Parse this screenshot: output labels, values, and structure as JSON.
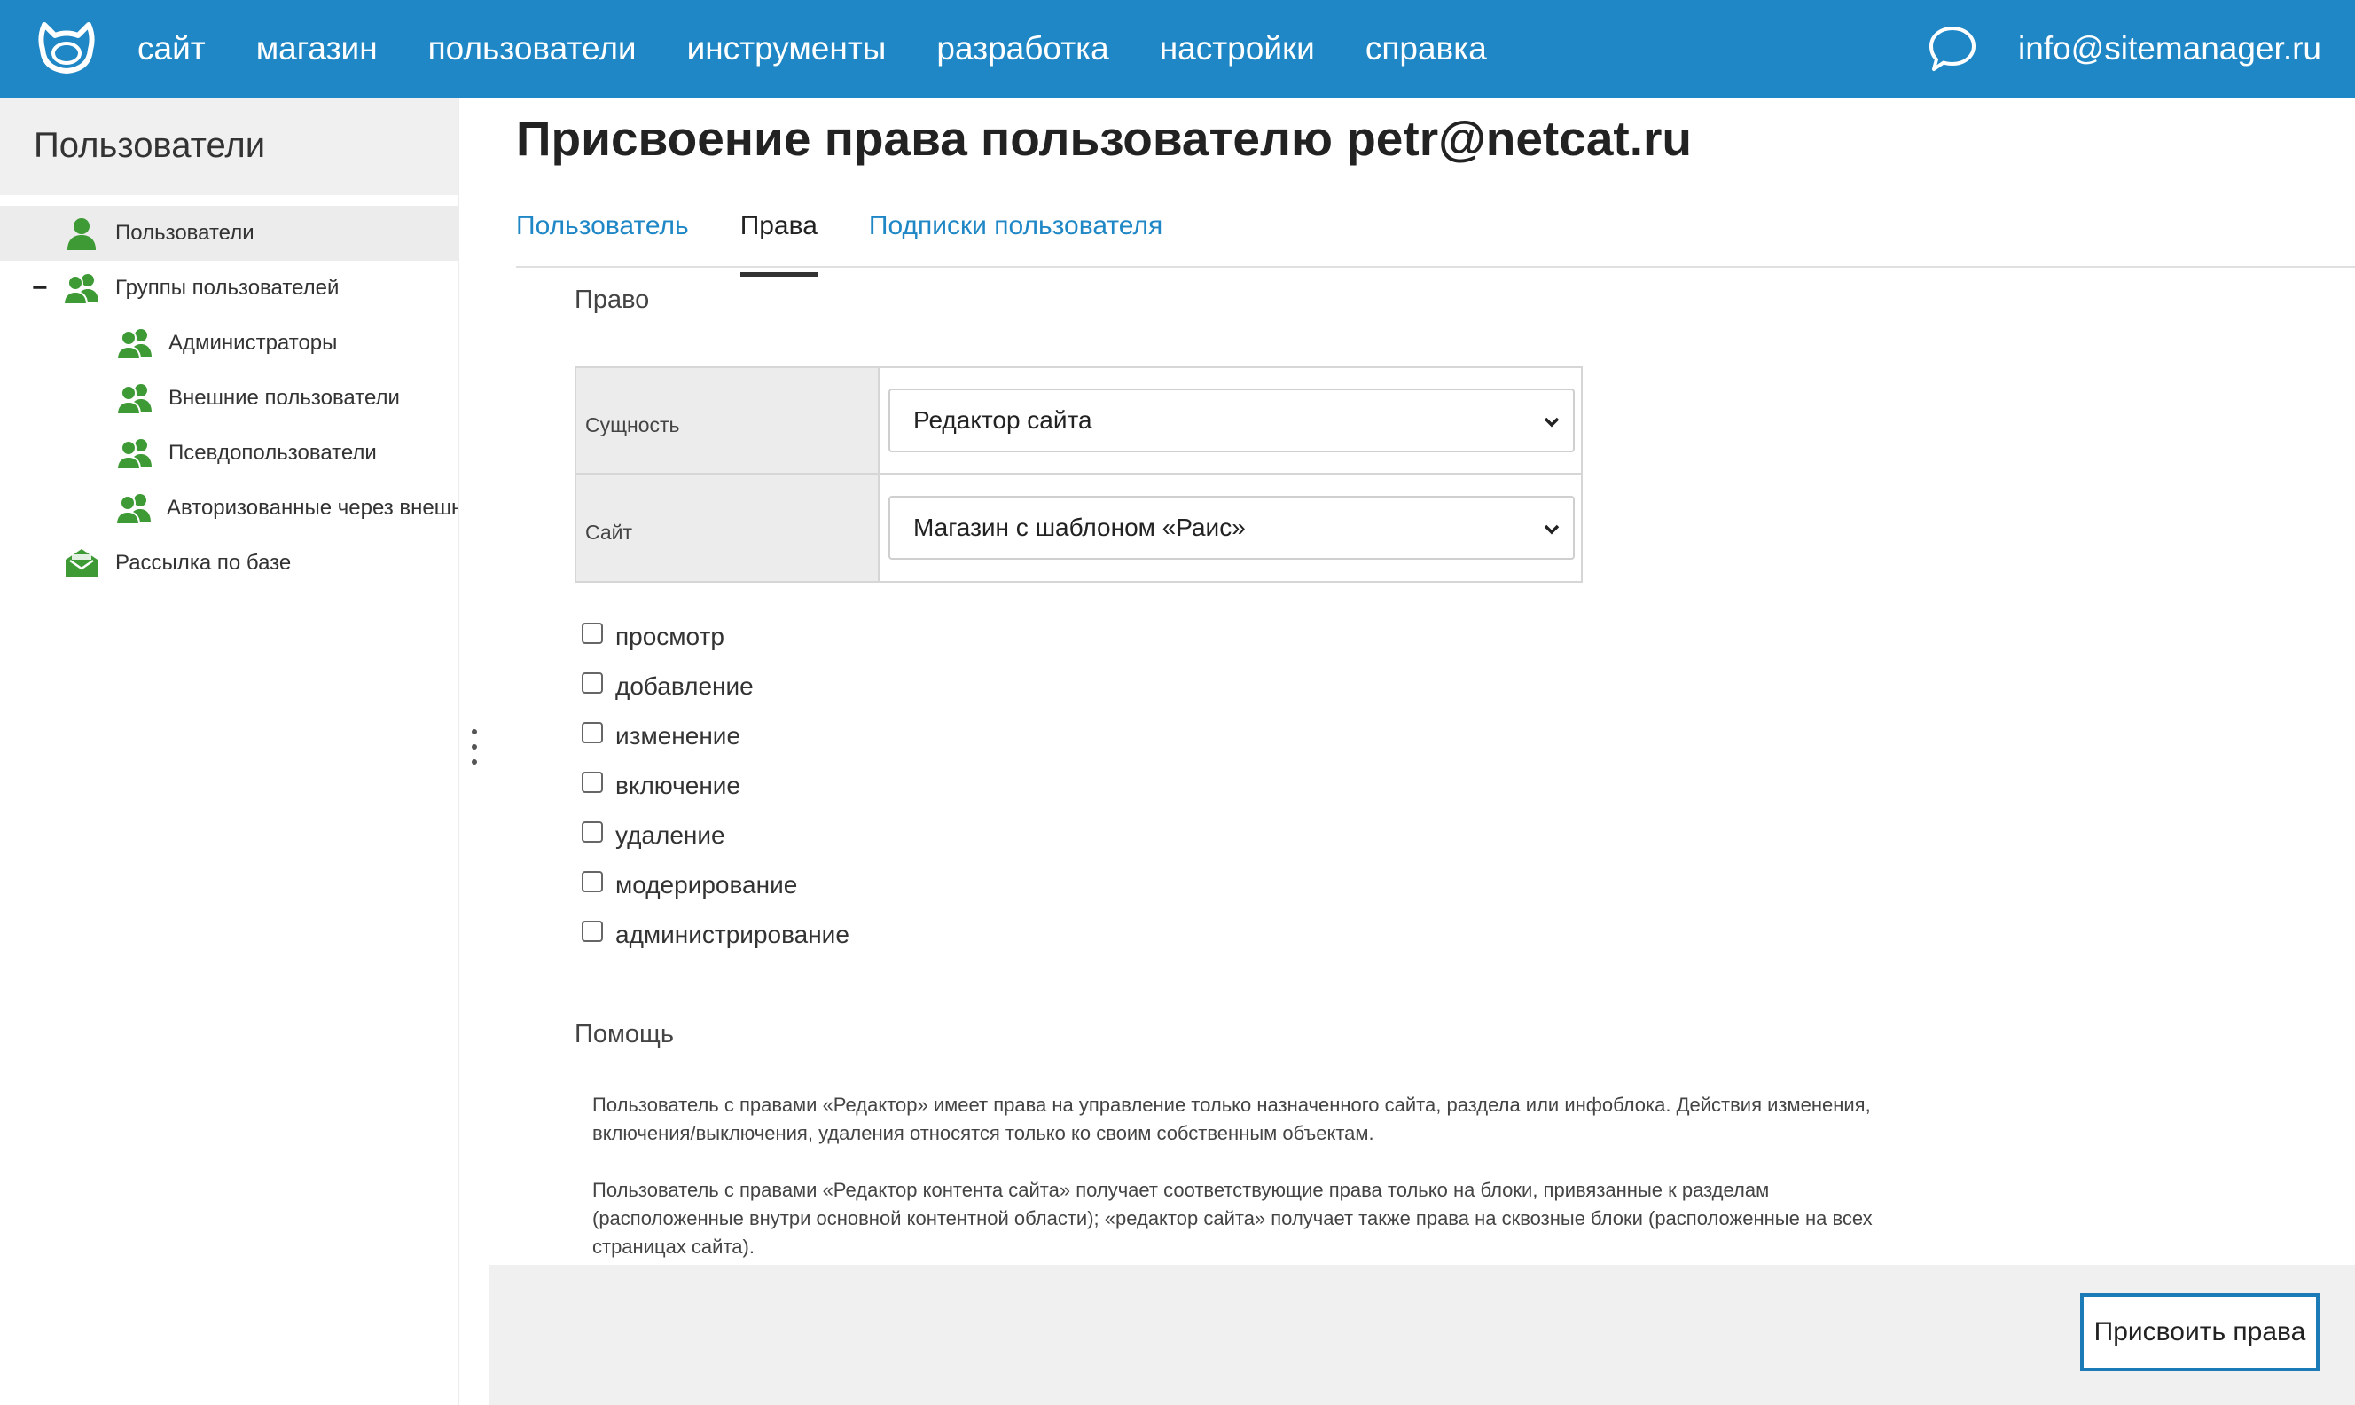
{
  "topbar": {
    "nav": [
      "сайт",
      "магазин",
      "пользователи",
      "инструменты",
      "разработка",
      "настройки",
      "справка"
    ],
    "user_email": "info@sitemanager.ru",
    "icons": {
      "logo": "netcat-logo-icon",
      "chat": "chat-bubble-icon"
    },
    "colors": {
      "bar": "#1f87c5"
    }
  },
  "sidebar": {
    "title": "Пользователи",
    "tree": [
      {
        "label": "Пользователи",
        "icon": "user-icon",
        "selected": true
      },
      {
        "label": "Группы пользователей",
        "icon": "users-group-icon",
        "toggle": "−",
        "expanded": true
      },
      {
        "label": "Администраторы",
        "icon": "users-group-icon"
      },
      {
        "label": "Внешние пользователи",
        "icon": "users-group-icon"
      },
      {
        "label": "Псевдопользователи",
        "icon": "users-group-icon"
      },
      {
        "label": "Авторизованные через внешн",
        "icon": "users-group-icon"
      },
      {
        "label": "Рассылка по базе",
        "icon": "mail-icon"
      }
    ],
    "colors": {
      "icon": "#3d9a35"
    }
  },
  "main": {
    "title": "Присвоение права пользователю petr@netcat.ru",
    "tabs": [
      {
        "label": "Пользователь",
        "active": false
      },
      {
        "label": "Права",
        "active": true
      },
      {
        "label": "Подписки пользователя",
        "active": false
      }
    ],
    "rights_section_title": "Право",
    "form": {
      "entity_label": "Сущность",
      "entity_value": "Редактор сайта",
      "site_label": "Сайт",
      "site_value": "Магазин с шаблоном «Раис»"
    },
    "permissions": [
      "просмотр",
      "добавление",
      "изменение",
      "включение",
      "удаление",
      "модерирование",
      "администрирование"
    ],
    "help_title": "Помощь",
    "help_paragraphs": [
      "Пользователь с правами «Редактор» имеет права на управление только назначенного сайта, раздела или инфоблока. Действия изменения, включения/выключения, удаления относятся только ко своим собственным объектам.",
      "Пользователь с правами «Редактор контента сайта» получает соответствующие права только на блоки, привязанные к разделам (расположенные внутри основной контентной области); «редактор сайта» получает также права на сквозные блоки (расположенные на всех страницах сайта)."
    ],
    "submit_label": "Присвоить права"
  }
}
